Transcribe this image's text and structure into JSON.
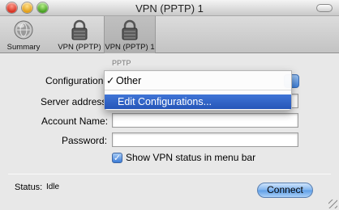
{
  "window": {
    "title": "VPN (PPTP) 1"
  },
  "toolbar": {
    "items": [
      {
        "label": "Summary",
        "icon": "globe-icon"
      },
      {
        "label": "VPN (PPTP)",
        "icon": "lock-icon"
      },
      {
        "label": "VPN (PPTP) 1",
        "icon": "lock-icon"
      }
    ]
  },
  "form": {
    "section_header": "PPTP",
    "configuration_label": "Configuration",
    "server_address_label": "Server address",
    "account_name_label": "Account Name:",
    "password_label": "Password:",
    "account_name_value": "",
    "password_value": "",
    "show_status_checkbox": {
      "label": "Show VPN status in menu bar",
      "checked": true,
      "glyph": "✓"
    }
  },
  "menu": {
    "items": [
      {
        "label": "Other",
        "checked": true,
        "check_glyph": "✓"
      },
      {
        "label": "Edit Configurations...",
        "highlighted": true
      }
    ]
  },
  "status": {
    "label": "Status:",
    "value": "Idle"
  },
  "buttons": {
    "connect": "Connect"
  },
  "colors": {
    "accent": "#3f74d6",
    "highlight_text": "#ffffff"
  }
}
